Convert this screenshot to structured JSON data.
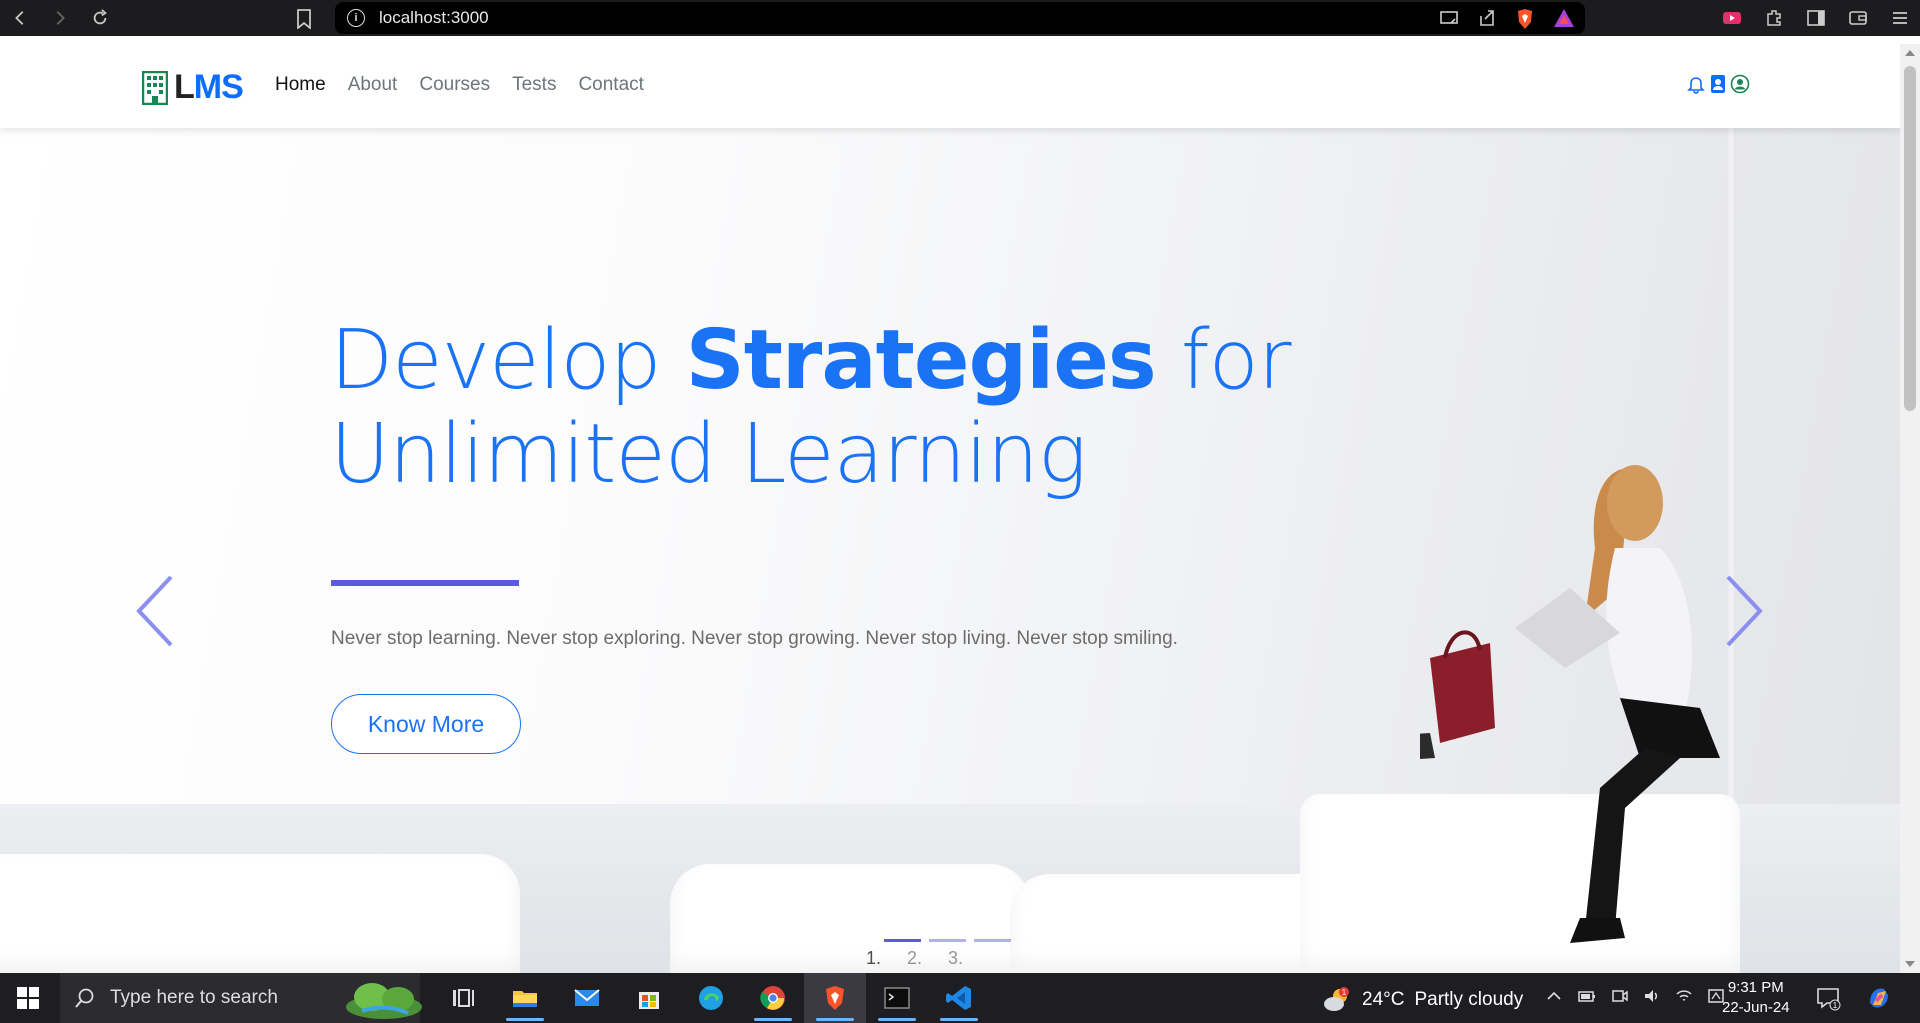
{
  "browser": {
    "url": "localhost:3000"
  },
  "navbar": {
    "brand": "LMS",
    "items": [
      {
        "label": "Home",
        "active": true
      },
      {
        "label": "About"
      },
      {
        "label": "Courses"
      },
      {
        "label": "Tests"
      },
      {
        "label": "Contact"
      }
    ],
    "icons": [
      "bell-icon",
      "id-badge-icon",
      "user-circle-icon"
    ]
  },
  "hero": {
    "headline_part1": "Develop ",
    "headline_bold": "Strategies",
    "headline_part2": " for",
    "headline_line2": "Unlimited Learning",
    "tagline": "Never stop learning. Never stop exploring. Never stop growing. Never stop living. Never stop smiling.",
    "button_label": "Know More",
    "slide_labels": [
      "1.",
      "2.",
      "3."
    ],
    "active_slide": 1,
    "accent_color": "#1a73f5",
    "bar_color": "#5b5bdd"
  },
  "taskbar": {
    "search_placeholder": "Type here to search",
    "weather_temp": "24°C",
    "weather_desc": "Partly cloudy",
    "time": "9:31 PM",
    "date": "22-Jun-24",
    "notification_count": "1",
    "weather_badge": "1"
  }
}
